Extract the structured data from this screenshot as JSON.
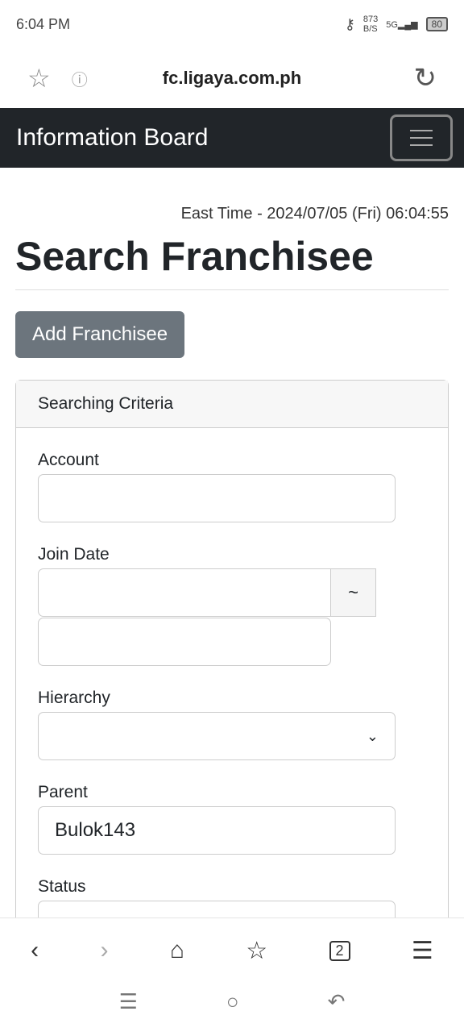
{
  "status": {
    "time": "6:04 PM",
    "speed_top": "873",
    "speed_unit": "B/S",
    "network": "5G",
    "battery": "80"
  },
  "browser": {
    "url": "fc.ligaya.com.ph",
    "tabs_count": "2"
  },
  "navbar": {
    "brand": "Information Board"
  },
  "page": {
    "time": "East Time - 2024/07/05 (Fri) 06:04:55",
    "title": "Search Franchisee",
    "add_label": "Add Franchisee"
  },
  "criteria": {
    "header": "Searching Criteria",
    "account_label": "Account",
    "account_value": "",
    "join_label": "Join Date",
    "join_sep": "~",
    "hierarchy_label": "Hierarchy",
    "hierarchy_value": "",
    "parent_label": "Parent",
    "parent_value": "Bulok143",
    "status_label": "Status"
  }
}
